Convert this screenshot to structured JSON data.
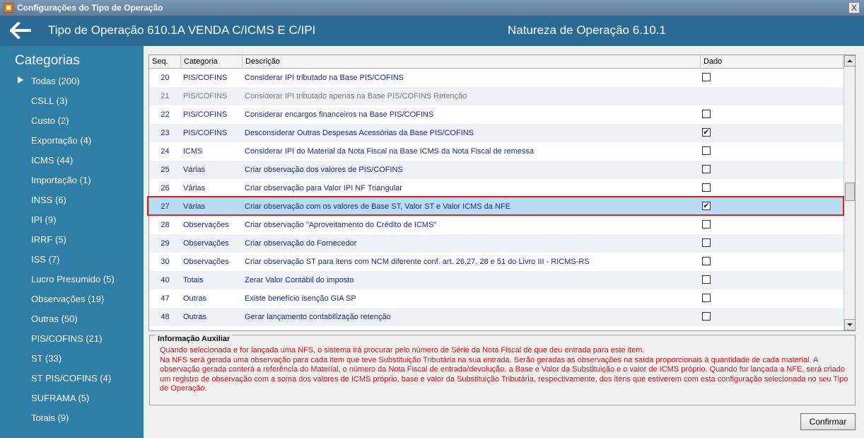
{
  "window": {
    "title": "Configurações do Tipo de Operação",
    "close_label": "X"
  },
  "header": {
    "operation_title": "Tipo de Operação 610.1A  VENDA C/ICMS E C/IPI",
    "nature_title": "Natureza de Operação 6.10.1"
  },
  "sidebar": {
    "title": "Categorias",
    "items": [
      "Todas (200)",
      "CSLL (3)",
      "Custo (2)",
      "Exportação (4)",
      "ICMS (44)",
      "Importação (1)",
      "INSS (6)",
      "IPI (9)",
      "IRRF (5)",
      "ISS (7)",
      "Lucro Presumido (5)",
      "Observações (19)",
      "Outras (50)",
      "PIS/COFINS (21)",
      "ST (33)",
      "ST PIS/COFINS (4)",
      "SUFRAMA (5)",
      "Totais (9)"
    ]
  },
  "grid": {
    "columns": {
      "seq": "Seq.",
      "category": "Categoria",
      "description": "Descrição",
      "value": "Dado"
    },
    "rows": [
      {
        "seq": "20",
        "category": "PIS/COFINS",
        "description": "Considerar IPI tributado na Base PIS/COFINS",
        "checked": ""
      },
      {
        "seq": "21",
        "category": "PIS/COFINS",
        "description": "Considerar IPI tributado apenas na Base PIS/COFINS Retenção",
        "checked": ""
      },
      {
        "seq": "22",
        "category": "PIS/COFINS",
        "description": "Considerar encargos financeiros na Base PIS/COFINS",
        "checked": ""
      },
      {
        "seq": "23",
        "category": "PIS/COFINS",
        "description": "Desconsiderar Outras Despesas Acessórias da Base PIS/COFINS",
        "checked": "✔"
      },
      {
        "seq": "24",
        "category": "ICMS",
        "description": "Considerar IPI do Material da Nota Fiscal na Base ICMS da Nota Fiscal de remessa",
        "checked": ""
      },
      {
        "seq": "25",
        "category": "Várias",
        "description": "Criar observação dos valores de PIS/COFINS",
        "checked": ""
      },
      {
        "seq": "26",
        "category": "Várias",
        "description": "Criar observação para Valor IPI NF Triangular",
        "checked": ""
      },
      {
        "seq": "27",
        "category": "Várias",
        "description": "Criar observação com os valores de Base ST, Valor ST e Valor ICMS da NFE",
        "checked": "✔"
      },
      {
        "seq": "28",
        "category": "Observações",
        "description": "Criar observação \"Aproveitamento do Crédito de ICMS\"",
        "checked": ""
      },
      {
        "seq": "29",
        "category": "Observações",
        "description": "Criar observação do Fornecedor",
        "checked": ""
      },
      {
        "seq": "30",
        "category": "Observações",
        "description": "Criar observação ST para itens com NCM diferente conf. art. 26,27, 28 e 51 do Livro III - RICMS-RS",
        "checked": ""
      },
      {
        "seq": "40",
        "category": "Totais",
        "description": "Zerar Valor Contábil do imposto",
        "checked": ""
      },
      {
        "seq": "47",
        "category": "Outras",
        "description": "Existe benefício isenção GIA SP",
        "checked": ""
      },
      {
        "seq": "48",
        "category": "Outras",
        "description": "Gerar lançamento contabilização retenção",
        "checked": ""
      }
    ]
  },
  "info": {
    "legend": "Informação Auxiliar",
    "line1": "Quando selecionada e for lançada uma NFS, o sistema irá procurar pelo número de Série da Nota Fiscal de que deu entrada para este item.",
    "line2": "Na NFS será gerada uma observação para cada item que teve Substituição Tributária na sua entrada. Serão geradas as observações na saída proporcionais à quantidade de cada material. A observação gerada conterá a referência do Material, o número da Nota Fiscal de entrada/devolução, a Base e Valor da Substituição e o valor de ICMS próprio. Quando for lançada a NFE, será criado um registro de observação com a soma dos valores de ICMS próprio, base e valor da Substituição Tributária, respectivamente, dos itens que estiverem com esta configuração selecionada no seu Tipo de Operação."
  },
  "buttons": {
    "confirm": "Confirmar"
  }
}
